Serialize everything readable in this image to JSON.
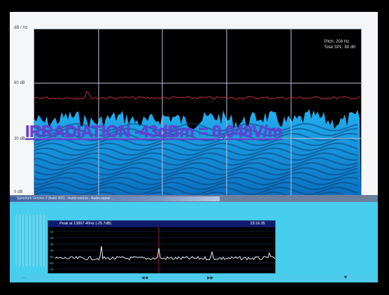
{
  "spectrum": {
    "y_top_label": "dB / Hz",
    "tick_60": "60 dB",
    "tick_30": "30 dB",
    "tick_0": "0 dB",
    "info_pitch": "Pitch: 208 Hz",
    "info_spl": "Total SPL: 88 dB"
  },
  "overlay": {
    "caption": "IRRADIATION -43dBm = 0,048V/m"
  },
  "window": {
    "title": "Spectrum Version 2 (build 305) - Audio source - Audio signal ..."
  },
  "mini_spectrum": {
    "peak_text": "Peak at 13867.40Hz (-25.7dB)",
    "clock": "23:16:35",
    "ticks": [
      "-10",
      "-20",
      "-30",
      "-40",
      "-50",
      "-60",
      "-70"
    ]
  },
  "status": {
    "left": "...",
    "mid1": "◀◀",
    "mid2": "▶▶",
    "right": "■"
  },
  "colors": {
    "bg_dark": "#000000",
    "spectrum_fill": "#1aa0e6",
    "avg_line": "#c0303a",
    "caption": "#6a3fd6",
    "lower_window": "#47cdee"
  }
}
